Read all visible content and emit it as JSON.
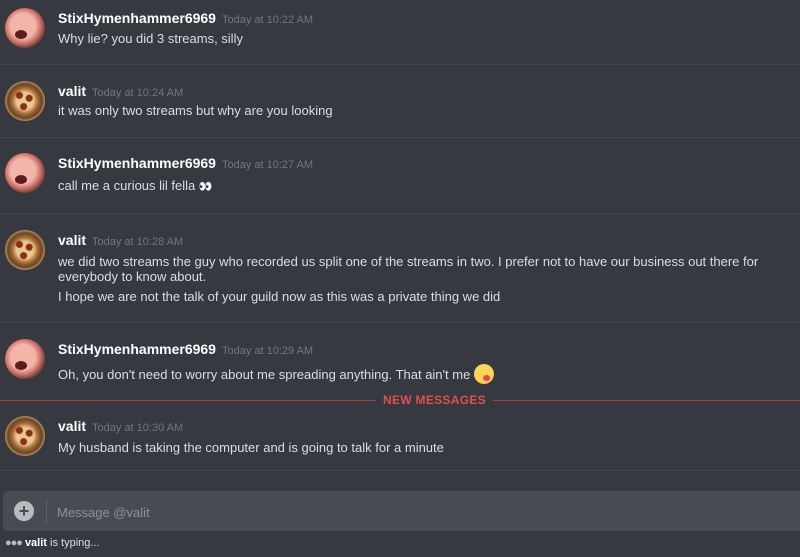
{
  "messages": [
    {
      "username": "StixHymenhammer6969",
      "timestamp": "Today at 10:22 AM",
      "lines": [
        "Why lie? you did 3 streams, silly"
      ]
    },
    {
      "username": "valit",
      "timestamp": "Today at 10:24 AM",
      "lines": [
        "it was only two streams but why are you looking"
      ]
    },
    {
      "username": "StixHymenhammer6969",
      "timestamp": "Today at 10:27 AM",
      "lines": [
        "call me a curious lil fella"
      ]
    },
    {
      "username": "valit",
      "timestamp": "Today at 10:28 AM",
      "lines": [
        "we did two streams the guy who recorded us split one of the streams in two.  I prefer not to have our business out there for everybody to know about.",
        "I hope we are not the talk of your guild now as this was a private thing we did"
      ]
    },
    {
      "username": "StixHymenhammer6969",
      "timestamp": "Today at 10:29 AM",
      "lines": [
        "Oh, you don't need to worry about me spreading anything. That ain't me"
      ]
    },
    {
      "username": "valit",
      "timestamp": "Today at 10:30 AM",
      "lines": [
        "My husband is taking the computer and is going to talk for a minute"
      ]
    }
  ],
  "divider": {
    "label": "NEW MESSAGES"
  },
  "input": {
    "placeholder": "Message @valit"
  },
  "typing": {
    "user": "valit",
    "text": "is typing..."
  },
  "emojis": {
    "eyes": "👀",
    "yum": "yum-face-emoji"
  },
  "colors": {
    "background": "#36393f",
    "input": "#484c52",
    "new_divider": "#e04f4f",
    "timestamp": "#72767d"
  }
}
